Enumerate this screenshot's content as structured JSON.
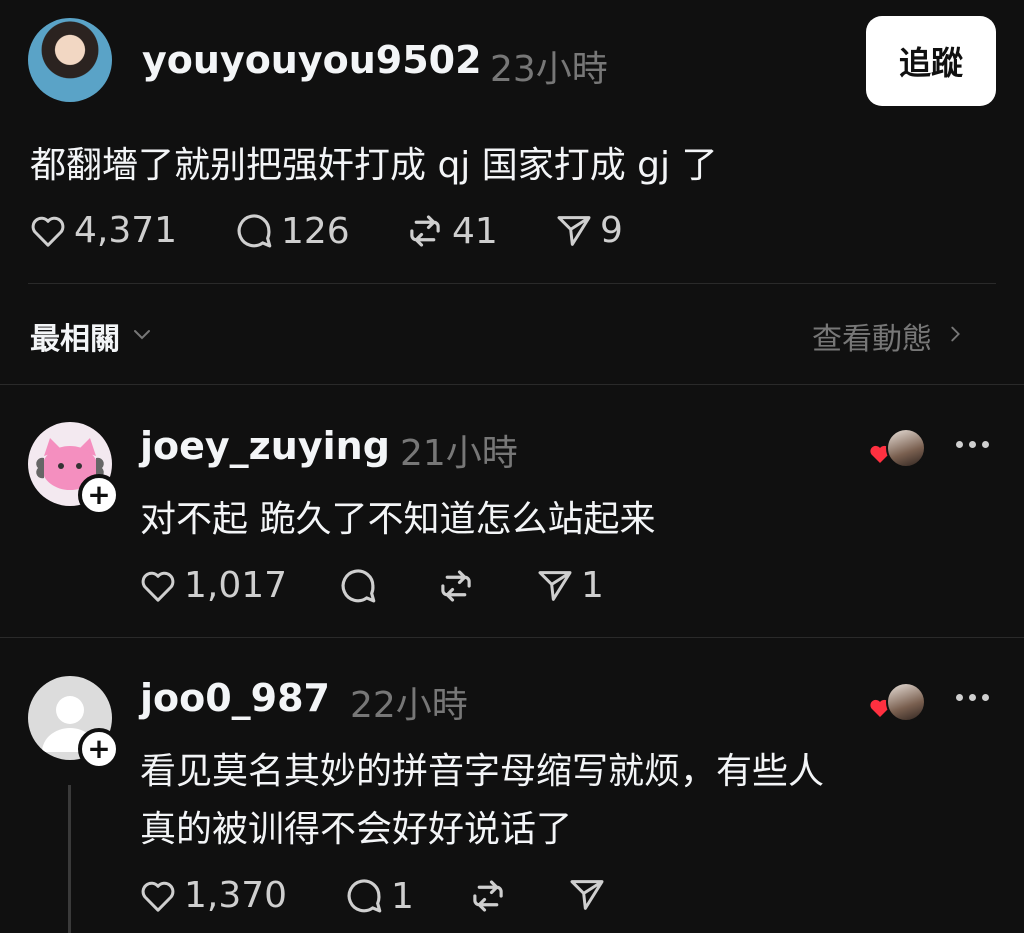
{
  "post": {
    "username": "youyouyou9502",
    "time": "23小時",
    "follow_label": "追蹤",
    "text": "都翻墻了就别把强奸打成 qj 国家打成 gj 了",
    "likes": "4,371",
    "replies": "126",
    "reposts": "41",
    "shares": "9"
  },
  "sort": {
    "label": "最相關",
    "activity_label": "查看動態"
  },
  "comments": [
    {
      "username": "joey_zuying",
      "time": "21小時",
      "text": "对不起 跪久了不知道怎么站起来",
      "likes": "1,017",
      "shares": "1"
    },
    {
      "username": "joo0_987",
      "time": "22小時",
      "text_line1": "看见莫名其妙的拼音字母缩写就烦，有些人",
      "text_line2": "真的被训得不会好好说话了",
      "likes": "1,370",
      "replies": "1"
    }
  ],
  "colors": {
    "background": "#101010",
    "text": "#f3f5f7",
    "muted": "#777777",
    "heart": "#ff3040"
  },
  "icons": {
    "like": "heart-icon",
    "reply": "comment-icon",
    "repost": "repost-icon",
    "share": "send-icon",
    "more": "more-icon",
    "chevron": "chevron-down-icon"
  }
}
